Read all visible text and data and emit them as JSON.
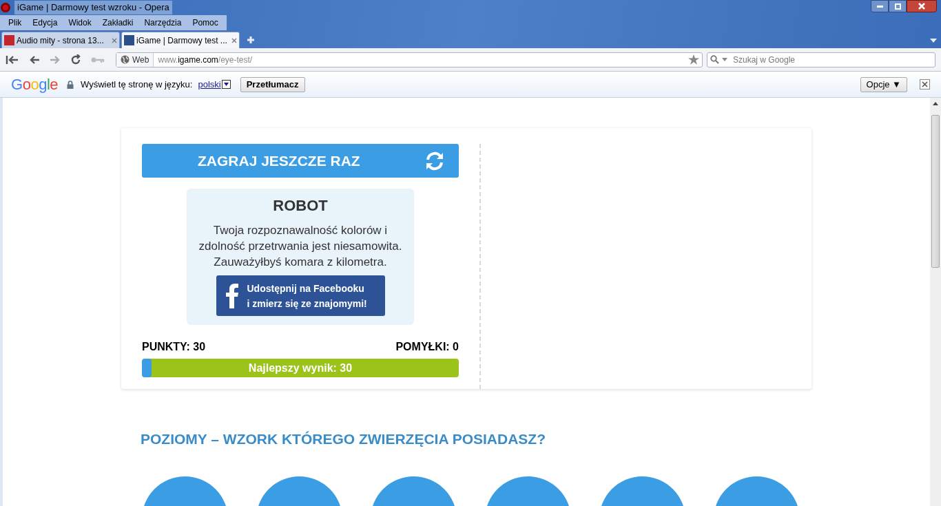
{
  "window": {
    "title": "iGame | Darmowy test wzroku - Opera"
  },
  "menu": [
    "Plik",
    "Edycja",
    "Widok",
    "Zakładki",
    "Narzędzia",
    "Pomoc"
  ],
  "tabs": [
    {
      "label": "Audio mity - strona 13...",
      "selected": false
    },
    {
      "label": "iGame | Darmowy test ...",
      "selected": true
    }
  ],
  "address_bar": {
    "badge": "Web",
    "url_host": "www.",
    "url_domain": "igame.com",
    "url_path": "/eye-test/"
  },
  "search": {
    "placeholder": "Szukaj w Google"
  },
  "translate_bar": {
    "logo": "Google",
    "prompt": "Wyświetl tę stronę w języku:",
    "language": "polski",
    "translate_button": "Przetłumacz",
    "options_button": "Opcje ▼"
  },
  "game": {
    "play_again": "ZAGRAJ JESZCZE RAZ",
    "result_title": "ROBOT",
    "result_text": "Twoja rozpoznawalność kolorów i zdolność przetrwania jest niesamowita. Zauważyłbyś komara z kilometra.",
    "share_line_1": "Udostępnij na Facebooku",
    "share_line_2": "i zmierz się ze znajomymi!",
    "points": "PUNKTY: 30",
    "mistakes": "POMYŁKI: 0",
    "best": "Najlepszy wynik: 30",
    "level": 0.03
  },
  "levels_heading": "POZIOMY – WZORK KTÓREGO ZWIERZĘCIA POSIADASZ?",
  "level_badges": [
    {
      "kind": "circle"
    },
    {
      "kind": "circle"
    },
    {
      "kind": "circle"
    },
    {
      "kind": "circle"
    },
    {
      "kind": "circle"
    },
    {
      "kind": "circle"
    }
  ]
}
